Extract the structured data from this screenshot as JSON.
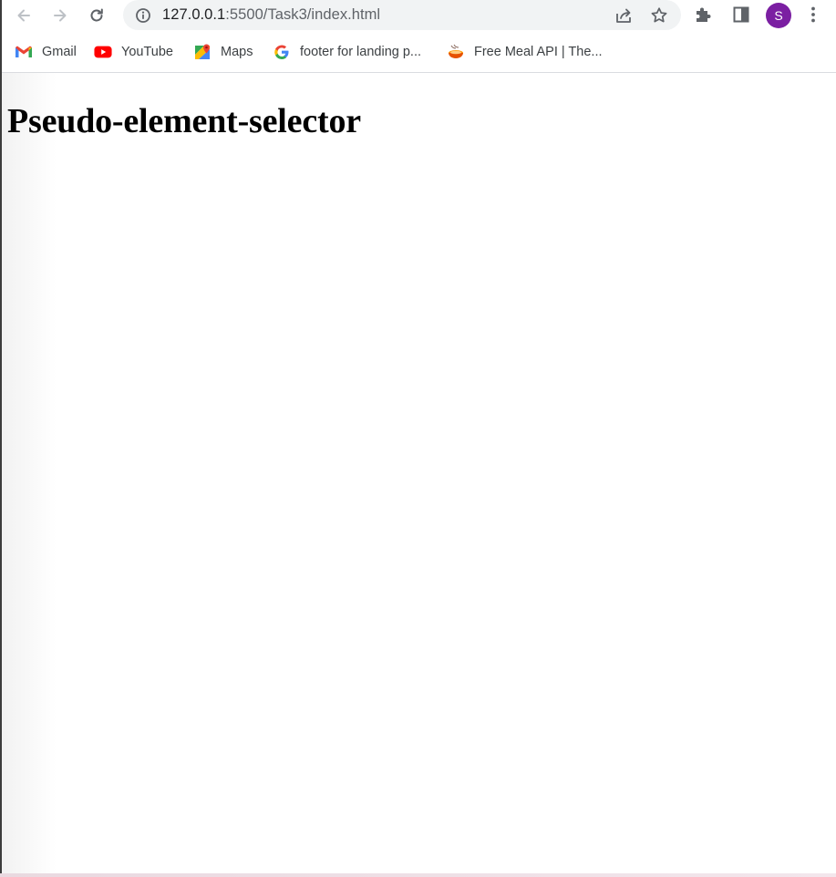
{
  "browser": {
    "address_bar": {
      "host": "127.0.0.1",
      "path": ":5500/Task3/index.html"
    },
    "profile_initial": "S",
    "colors": {
      "avatar": "#7b1fa2",
      "toolbar_icons": "#5f6368",
      "omnibox_bg": "#f1f3f4"
    }
  },
  "bookmarks": [
    {
      "label": "Gmail",
      "icon": "gmail-icon"
    },
    {
      "label": "YouTube",
      "icon": "youtube-icon"
    },
    {
      "label": "Maps",
      "icon": "maps-icon"
    },
    {
      "label": "footer for landing p...",
      "icon": "google-icon"
    },
    {
      "label": "Free Meal API | The...",
      "icon": "meal-icon"
    }
  ],
  "page": {
    "heading": "Pseudo-element-selector"
  }
}
